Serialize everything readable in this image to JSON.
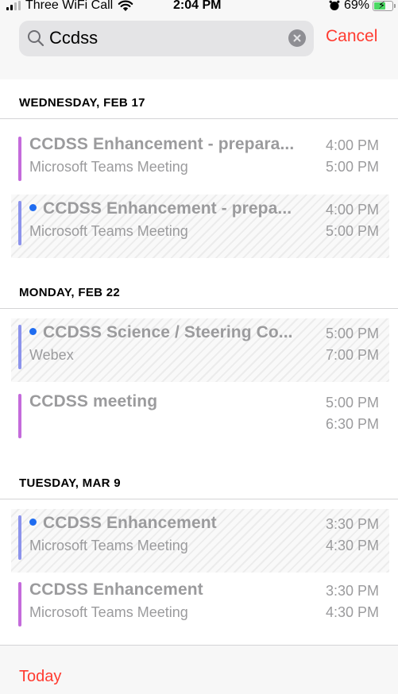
{
  "status_bar": {
    "carrier": "Three WiFi Call",
    "time": "2:04 PM",
    "battery": "69%",
    "battery_level": 0.69
  },
  "search": {
    "value": "Ccdss",
    "cancel_label": "Cancel"
  },
  "sections": [
    {
      "header": "WEDNESDAY, FEB 17",
      "events": [
        {
          "title": "CCDSS Enhancement - prepara...",
          "subtitle": "Microsoft Teams Meeting",
          "start": "4:00 PM",
          "end": "5:00 PM",
          "calendar_color": "#c46bdb",
          "unresponded": false
        },
        {
          "title": "CCDSS Enhancement - prepa...",
          "subtitle": "Microsoft Teams Meeting",
          "start": "4:00 PM",
          "end": "5:00 PM",
          "calendar_color": "#8c93ec",
          "unresponded": true
        }
      ]
    },
    {
      "header": "MONDAY, FEB 22",
      "events": [
        {
          "title": "CCDSS Science / Steering Co...",
          "subtitle": "Webex",
          "start": "5:00 PM",
          "end": "7:00 PM",
          "calendar_color": "#8c93ec",
          "unresponded": true
        },
        {
          "title": "CCDSS meeting",
          "subtitle": "",
          "start": "5:00 PM",
          "end": "6:30 PM",
          "calendar_color": "#c46bdb",
          "unresponded": false
        }
      ]
    },
    {
      "header": "TUESDAY, MAR 9",
      "events": [
        {
          "title": "CCDSS Enhancement",
          "subtitle": "Microsoft Teams Meeting",
          "start": "3:30 PM",
          "end": "4:30 PM",
          "calendar_color": "#8c93ec",
          "unresponded": true
        },
        {
          "title": "CCDSS Enhancement",
          "subtitle": "Microsoft Teams Meeting",
          "start": "3:30 PM",
          "end": "4:30 PM",
          "calendar_color": "#c46bdb",
          "unresponded": false
        }
      ]
    }
  ],
  "toolbar": {
    "today_label": "Today"
  },
  "colors": {
    "accent": "#ff3b30",
    "invitation_dot": "#1f6cf0",
    "muted_text": "#9b9b9d"
  },
  "icons": [
    "signal-icon",
    "wifi-icon",
    "alarm-icon",
    "battery-icon",
    "search-icon",
    "clear-icon"
  ]
}
